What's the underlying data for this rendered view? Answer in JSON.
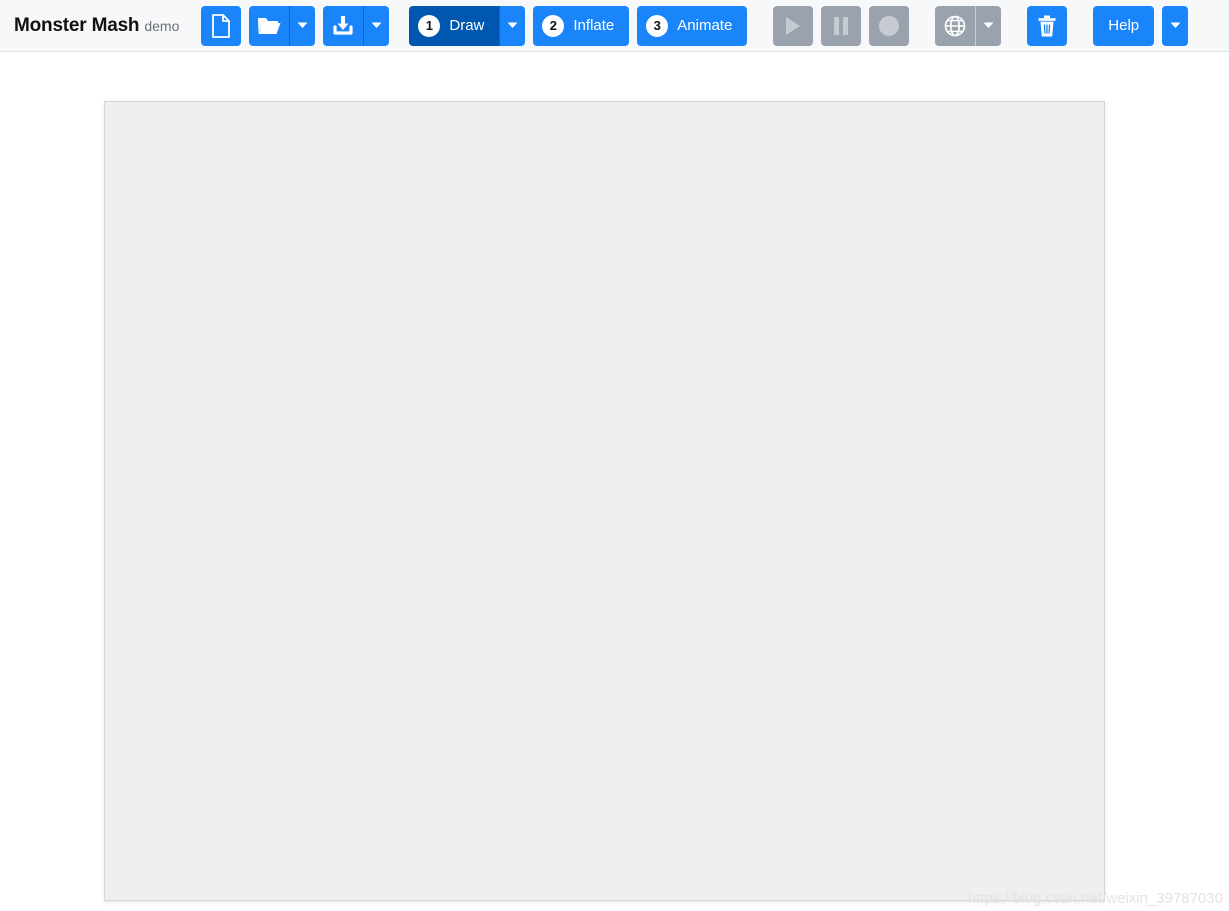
{
  "app": {
    "title": "Monster Mash",
    "subtitle": "demo"
  },
  "toolbar": {
    "file_group": {
      "new_label": "new-file",
      "new_icon": "document-icon",
      "open_label": "open-file",
      "open_icon": "folder-open-icon",
      "open_caret_icon": "chevron-down-icon",
      "save_label": "save-file",
      "save_icon": "download-icon",
      "save_caret_icon": "chevron-down-icon"
    },
    "steps": [
      {
        "number": "1",
        "label": "Draw",
        "state": "active",
        "has_caret": true,
        "caret_icon": "chevron-down-icon"
      },
      {
        "number": "2",
        "label": "Inflate",
        "state": "normal",
        "has_caret": false
      },
      {
        "number": "3",
        "label": "Animate",
        "state": "normal",
        "has_caret": false
      }
    ],
    "playback": [
      {
        "name": "play-button",
        "icon": "play-icon",
        "state": "disabled"
      },
      {
        "name": "pause-button",
        "icon": "pause-icon",
        "state": "disabled"
      },
      {
        "name": "record-button",
        "icon": "record-icon",
        "state": "disabled"
      }
    ],
    "globe": {
      "name": "globe-button",
      "icon": "globe-icon",
      "state": "disabled",
      "caret_icon": "chevron-down-icon"
    },
    "delete": {
      "name": "delete-button",
      "icon": "trash-icon"
    },
    "help": {
      "label": "Help",
      "caret_icon": "chevron-down-icon"
    }
  },
  "canvas": {
    "name": "drawing-canvas",
    "background_color": "#efefef",
    "border_color": "#d3d4d6"
  },
  "watermark": {
    "text": "https://blog.csdn.net/weixin_39787030"
  },
  "colors": {
    "accent_blue": "#1a85fb",
    "active_blue": "#0057b0",
    "disabled_gray": "#9aa3ad",
    "disabled_icon": "#c5cbd1",
    "toolbar_bg": "#f7f8fa"
  }
}
